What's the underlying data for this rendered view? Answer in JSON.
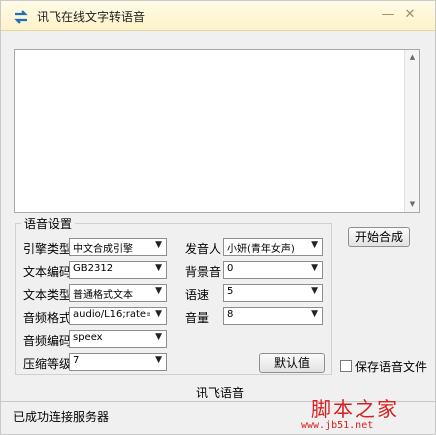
{
  "window": {
    "title": "讯飞在线文字转语音",
    "minimize_glyph": "—",
    "close_glyph": "✕"
  },
  "text_input": {
    "value": ""
  },
  "settings": {
    "group_title": "语音设置",
    "engine_type": {
      "label": "引擎类型",
      "value": "中文合成引擎"
    },
    "speaker": {
      "label": "发音人",
      "value": "小妍(青年女声)"
    },
    "text_encoding": {
      "label": "文本编码",
      "value": "GB2312"
    },
    "background_sound": {
      "label": "背景音",
      "value": "0"
    },
    "text_type": {
      "label": "文本类型",
      "value": "普通格式文本"
    },
    "speed": {
      "label": "语速",
      "value": "5"
    },
    "audio_format": {
      "label": "音频格式",
      "value": "audio/L16;rate="
    },
    "volume": {
      "label": "音量",
      "value": "8"
    },
    "audio_encoding": {
      "label": "音频编码",
      "value": "speex"
    },
    "compression_level": {
      "label": "压缩等级",
      "value": "7"
    },
    "default_button": "默认值"
  },
  "actions": {
    "start_button": "开始合成",
    "save_audio_label": "保存语音文件",
    "save_audio_checked": false
  },
  "footer": {
    "title": "讯飞语音",
    "status": "已成功连接服务器"
  },
  "watermark": {
    "big": "脚本之家",
    "small": "www.jb51.net"
  }
}
